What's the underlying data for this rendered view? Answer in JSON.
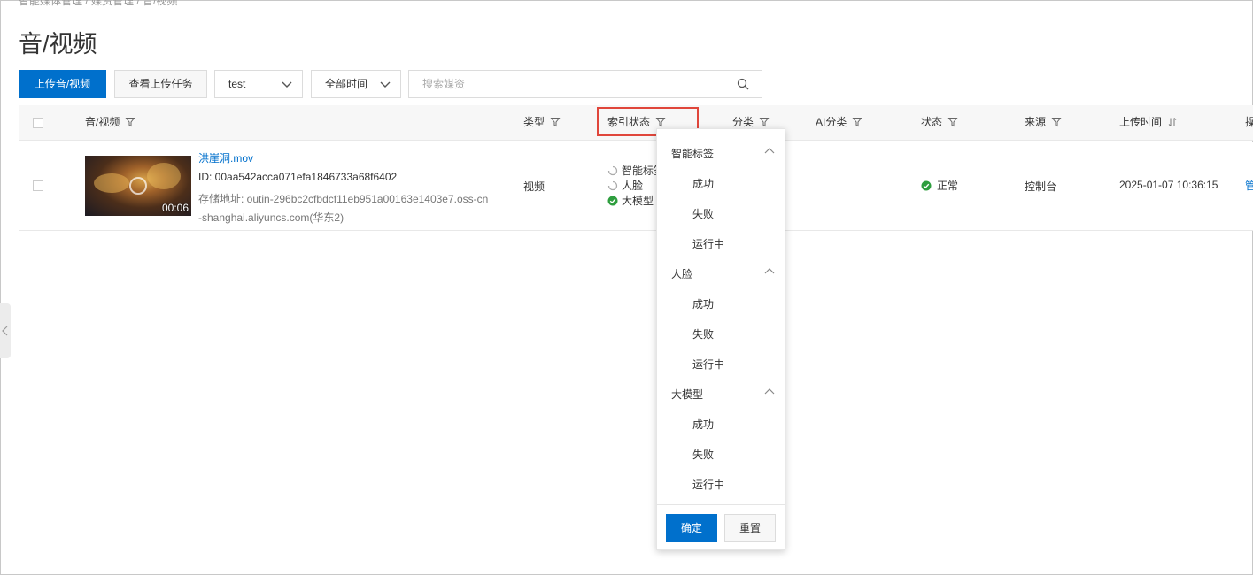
{
  "breadcrumb": "智能媒体管理 / 媒资管理 / 音/视频",
  "page": {
    "title": "音/视频"
  },
  "toolbar": {
    "upload_label": "上传音/视频",
    "tasks_label": "查看上传任务",
    "project_select": "test",
    "time_select": "全部时间",
    "search_placeholder": "搜索媒资"
  },
  "table": {
    "columns": {
      "media": "音/视频",
      "type": "类型",
      "index_status": "索引状态",
      "category": "分类",
      "ai_category": "AI分类",
      "status": "状态",
      "source": "来源",
      "upload_time": "上传时间",
      "action": "操"
    },
    "row": {
      "file_name": "洪崖洞.mov",
      "id_text": "ID:  00aa542acca071efa1846733a68f6402",
      "storage_text": "存储地址:  outin-296bc2cfbdcf11eb951a00163e1403e7.oss-cn-shanghai.aliyuncs.com(华东2)",
      "duration": "00:06",
      "type": "视频",
      "index_items": [
        {
          "label": "智能标签",
          "state": "running"
        },
        {
          "label": "人脸",
          "state": "running"
        },
        {
          "label": "大模型",
          "state": "success"
        }
      ],
      "status": "正常",
      "source": "控制台",
      "upload_time": "2025-01-07 10:36:15",
      "action_cut": "管"
    }
  },
  "filter_dropdown": {
    "groups": [
      {
        "label": "智能标签",
        "options": [
          "成功",
          "失败",
          "运行中"
        ]
      },
      {
        "label": "人脸",
        "options": [
          "成功",
          "失败",
          "运行中"
        ]
      },
      {
        "label": "大模型",
        "options": [
          "成功",
          "失败",
          "运行中"
        ]
      }
    ],
    "confirm_label": "确定",
    "reset_label": "重置"
  },
  "colors": {
    "accent": "#0070cc",
    "success": "#2e9e3e",
    "highlight": "#e0463b"
  }
}
